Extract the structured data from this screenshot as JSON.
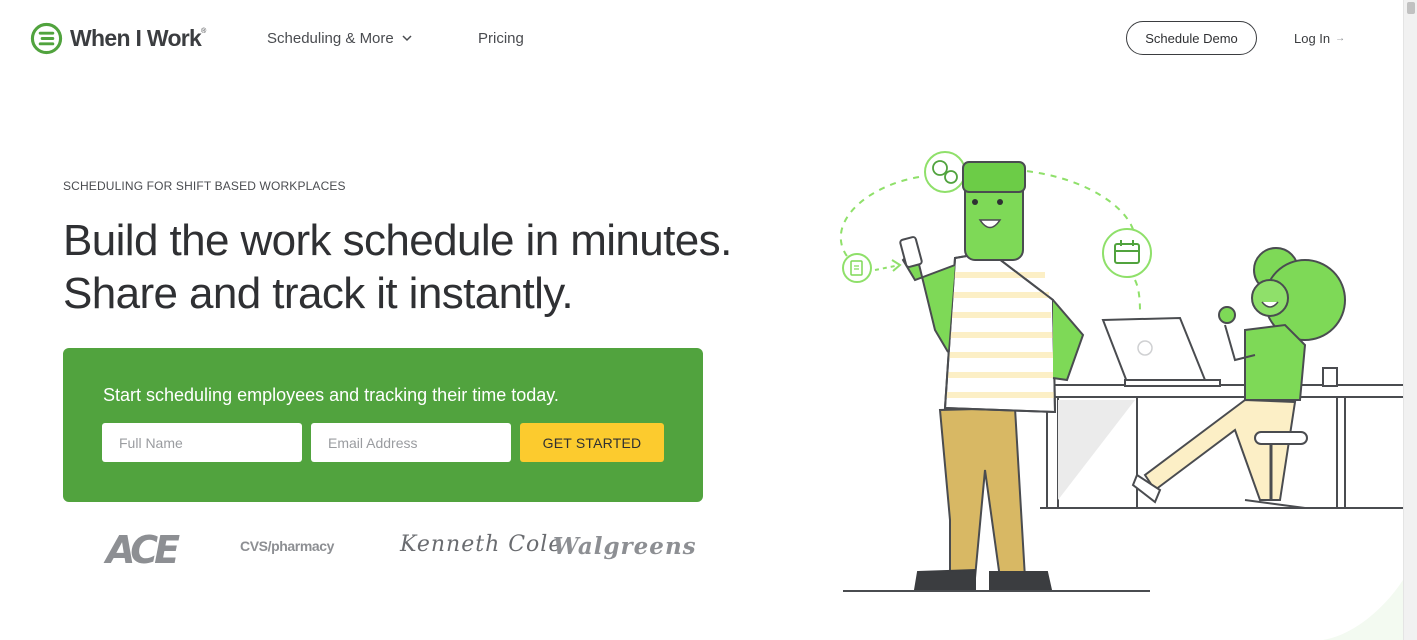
{
  "header": {
    "logo_text": "When I Work",
    "logo_reg": "®",
    "nav": {
      "scheduling_label": "Scheduling & More",
      "pricing_label": "Pricing"
    },
    "schedule_demo_label": "Schedule Demo",
    "login_label": "Log In",
    "login_arrow": "→"
  },
  "hero": {
    "eyebrow": "SCHEDULING FOR SHIFT BASED WORKPLACES",
    "headline_line1": "Build the work schedule in minutes.",
    "headline_line2": "Share and track it instantly."
  },
  "signup": {
    "title": "Start scheduling employees and tracking their time today.",
    "name_placeholder": "Full Name",
    "name_value": "",
    "email_placeholder": "Email Address",
    "email_value": "",
    "cta_label": "GET STARTED"
  },
  "customer_logos": {
    "ace": "ACE",
    "cvs_main": "CVS",
    "cvs_sub": "/pharmacy",
    "kenneth_cole": "Kenneth Cole",
    "walgreens": "Walgreens"
  },
  "colors": {
    "brand_green": "#51a33e",
    "cta_yellow": "#fccb2e",
    "illustration_green": "#7ed957",
    "text_dark": "#2f3033"
  },
  "icons": [
    "when-i-work-logo-icon",
    "chevron-down-icon",
    "arrow-right-icon",
    "document-icon",
    "chat-bubbles-icon",
    "calendar-icon"
  ]
}
